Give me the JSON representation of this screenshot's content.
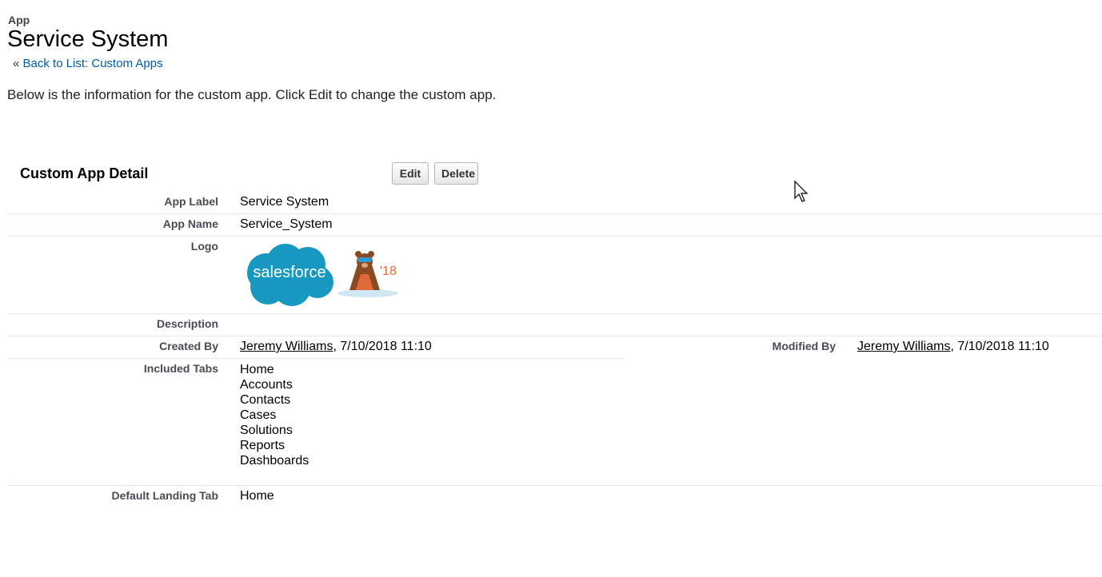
{
  "header": {
    "type_label": "App",
    "title": "Service System",
    "back_prefix": "«",
    "back_link": "Back to List: Custom Apps"
  },
  "intro_text": "Below is the information for the custom app. Click Edit to change the custom app.",
  "detail": {
    "section_title": "Custom App Detail",
    "edit_label": "Edit",
    "delete_label": "Delete",
    "app_label_label": "App Label",
    "app_label_value": "Service System",
    "app_name_label": "App Name",
    "app_name_value": "Service_System",
    "logo_label": "Logo",
    "logo_text": "salesforce",
    "logo_year": "'18",
    "description_label": "Description",
    "created_by_label": "Created By",
    "created_by_user": "Jeremy Williams",
    "created_by_date": ", 7/10/2018 11:10",
    "modified_by_label": "Modified By",
    "modified_by_user": "Jeremy Williams",
    "modified_by_date": ", 7/10/2018 11:10",
    "included_tabs_label": "Included Tabs",
    "included_tabs": [
      "Home",
      "Accounts",
      "Contacts",
      "Cases",
      "Solutions",
      "Reports",
      "Dashboards"
    ],
    "default_tab_label": "Default Landing Tab",
    "default_tab_value": "Home"
  },
  "colors": {
    "link": "#015ba7",
    "salesforce_blue": "#1798c1",
    "label": "#4a4a56"
  }
}
